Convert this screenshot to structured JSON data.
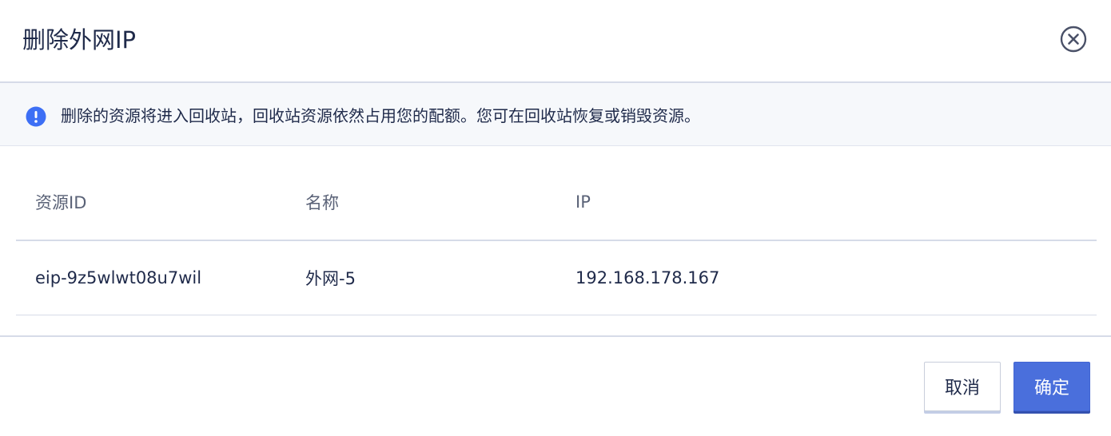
{
  "dialog": {
    "title": "删除外网IP",
    "close_icon": "close-circle-icon"
  },
  "notice": {
    "icon": "info-circle-icon",
    "icon_color": "#3d6ff5",
    "text": "删除的资源将进入回收站，回收站资源依然占用您的配额。您可在回收站恢复或销毁资源。"
  },
  "table": {
    "columns": [
      "资源ID",
      "名称",
      "IP"
    ],
    "rows": [
      {
        "id": "eip-9z5wlwt08u7wil",
        "name": "外网-5",
        "ip": "192.168.178.167"
      }
    ]
  },
  "footer": {
    "cancel_label": "取消",
    "confirm_label": "确定",
    "confirm_color": "#4a6fdc"
  }
}
